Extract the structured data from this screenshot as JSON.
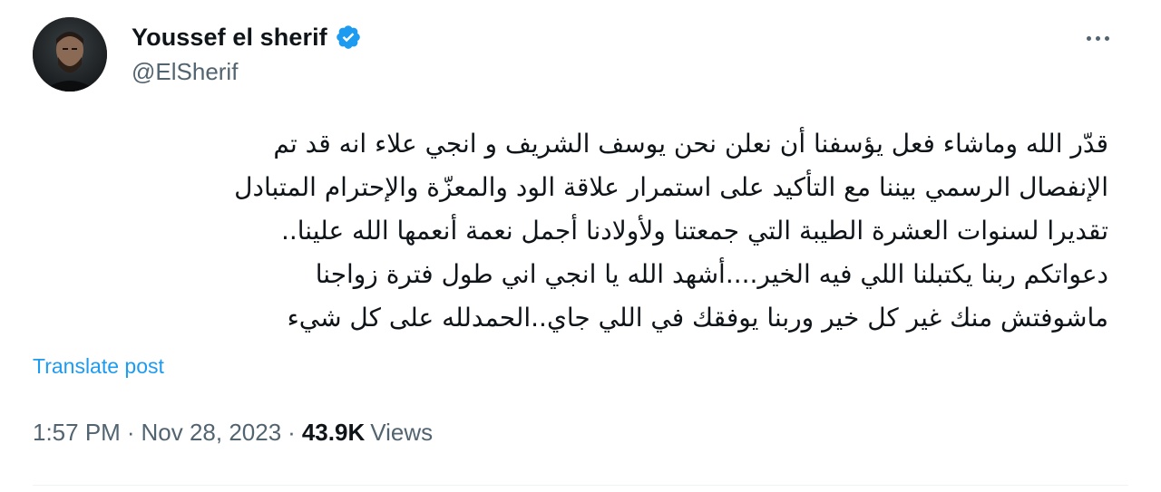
{
  "author": {
    "display_name": "Youssef el sherif",
    "handle": "@ElSherif",
    "verified": true,
    "verified_color": "#1d9bf0"
  },
  "more_button": {
    "icon": "more-horizontal-icon"
  },
  "tweet": {
    "lines": [
      "قدّر الله وماشاء فعل يؤسفنا أن نعلن نحن يوسف الشريف و انجي علاء انه قد تم",
      "الإنفصال الرسمي بيننا مع التأكيد على استمرار علاقة الود والمعزّة والإحترام المتبادل",
      "تقديرا لسنوات العشرة الطيبة التي جمعتنا ولأولادنا أجمل نعمة أنعمها الله علينا..",
      "دعواتكم ربنا يكتبلنا اللي فيه الخير....أشهد الله يا انجي اني طول فترة زواجنا",
      "ماشوفتش منك غير كل خير وربنا يوفقك في اللي جاي..الحمدلله على كل شيء"
    ],
    "translate_label": "Translate post"
  },
  "meta": {
    "time": "1:57 PM",
    "separator": "·",
    "date": "Nov 28, 2023",
    "views_count": "43.9K",
    "views_label": "Views"
  },
  "colors": {
    "text_primary": "#0f1419",
    "text_secondary": "#536471",
    "link": "#1d9bf0"
  }
}
